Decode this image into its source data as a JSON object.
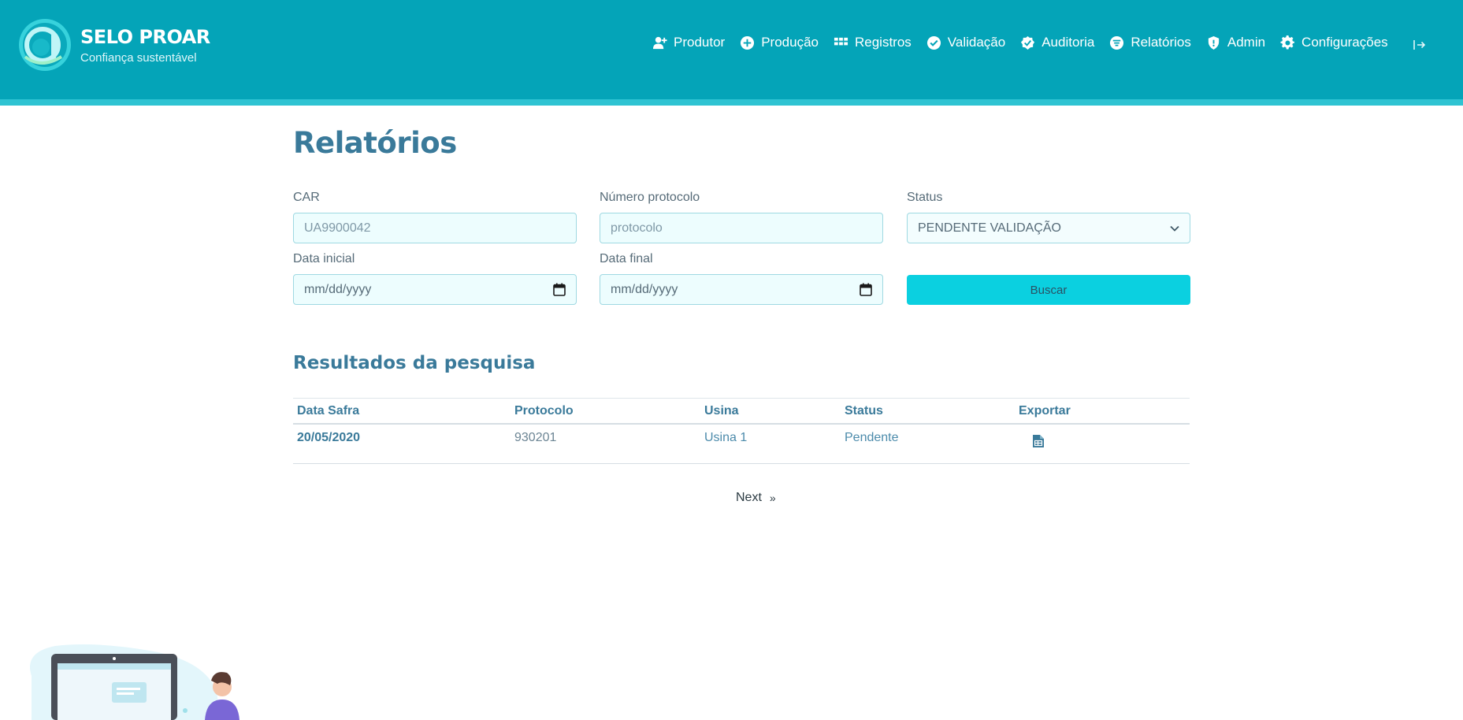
{
  "brand": {
    "name": "SELO PROAR",
    "tagline": "Confiança sustentável"
  },
  "nav": {
    "items": [
      {
        "label": "Produtor",
        "icon": "user-plus-icon"
      },
      {
        "label": "Produção",
        "icon": "plus-circle-icon"
      },
      {
        "label": "Registros",
        "icon": "grid-icon"
      },
      {
        "label": "Validação",
        "icon": "check-circle-icon"
      },
      {
        "label": "Auditoria",
        "icon": "badge-check-icon"
      },
      {
        "label": "Relatórios",
        "icon": "filter-icon"
      },
      {
        "label": "Admin",
        "icon": "shield-icon"
      },
      {
        "label": "Configurações",
        "icon": "gear-icon"
      }
    ],
    "logout_icon": "logout-icon"
  },
  "page": {
    "title": "Relatórios"
  },
  "filters": {
    "car_label": "CAR",
    "car_placeholder": "UA9900042",
    "protocol_label": "Número protocolo",
    "protocol_placeholder": "protocolo",
    "status_label": "Status",
    "status_value": "PENDENTE VALIDAÇÃO",
    "start_label": "Data inicial",
    "start_value": "mm/dd/yyyy",
    "end_label": "Data final",
    "end_value": "mm/dd/yyyy",
    "search_label": "Buscar"
  },
  "results": {
    "title": "Resultados da pesquisa",
    "columns": [
      "Data Safra",
      "Protocolo",
      "Usina",
      "Status",
      "Exportar"
    ],
    "rows": [
      {
        "data_safra": "20/05/2020",
        "protocolo": "930201",
        "usina": "Usina 1",
        "status": "Pendente",
        "export_icon": "spreadsheet-file-icon"
      }
    ]
  },
  "pagination": {
    "next_label": "Next",
    "next_arrow": "»"
  },
  "colors": {
    "header": "#04a4b8",
    "header_strip": "#2ec3d2",
    "accent_button": "#0bd0e0",
    "title_text": "#3a7a9a",
    "input_bg": "#edfdfe"
  }
}
